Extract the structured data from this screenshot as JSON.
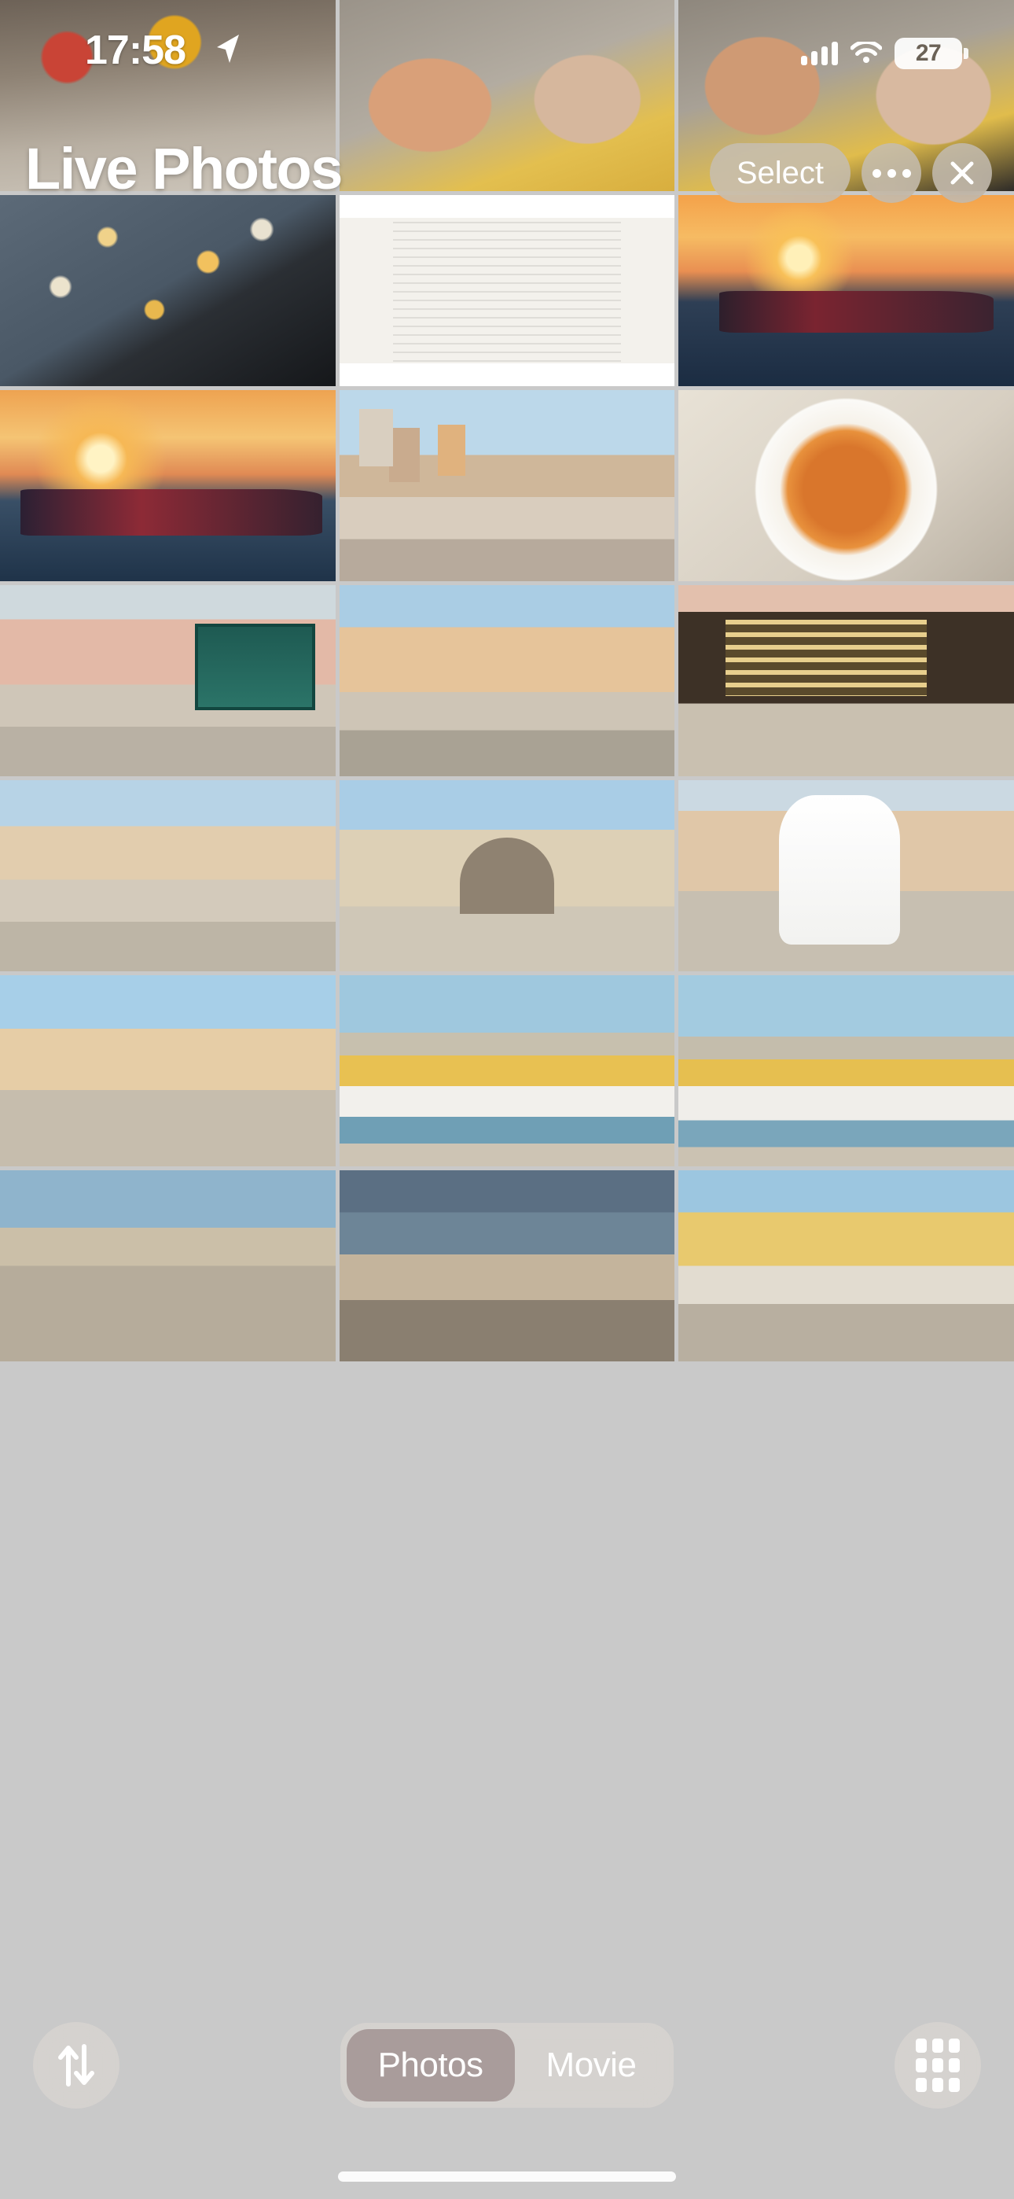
{
  "status_bar": {
    "time": "17:58",
    "location_icon": "location-arrow-icon",
    "cellular_icon": "cellular-signal-icon",
    "wifi_icon": "wifi-icon",
    "battery_level": "27"
  },
  "nav_bar": {
    "title": "Live Photos",
    "select_label": "Select",
    "more_icon": "ellipsis-icon",
    "close_icon": "close-x-icon"
  },
  "bottom_bar": {
    "sort_icon": "sort-arrows-icon",
    "grid_icon": "grid-view-icon",
    "segments": [
      {
        "label": "Photos",
        "active": true
      },
      {
        "label": "Movie",
        "active": false
      }
    ]
  },
  "colors": {
    "selection_border": "#ff0000",
    "grid_background": "#c9c9c9",
    "chrome_fill": "rgba(198,190,180,0.82)",
    "toolbar_fill": "rgba(214,211,207,0.86)",
    "segment_active": "rgba(150,133,133,0.70)"
  },
  "grid": {
    "columns": 3,
    "selected_index": 3,
    "items": [
      {
        "name": "crowd-street-scene",
        "art": "a-crowd",
        "selected": false
      },
      {
        "name": "selfie-couple-square-1",
        "art": "a-selfie1",
        "selected": false
      },
      {
        "name": "selfie-couple-square-2",
        "art": "a-selfie2",
        "selected": false
      },
      {
        "name": "star-projector-box",
        "art": "a-stars",
        "selected": false
      },
      {
        "name": "official-document-scan",
        "art": "a-doc",
        "selected": false
      },
      {
        "name": "sunset-boat-harbor",
        "art": "a-sunsetboat1",
        "selected": false
      },
      {
        "name": "taxi-boat-sunset",
        "art": "a-taxiboat",
        "selected": true
      },
      {
        "name": "old-town-waterfront",
        "art": "a-town",
        "selected": false
      },
      {
        "name": "vegetable-soup-bowl",
        "art": "a-soup",
        "selected": false
      },
      {
        "name": "cobblestone-street-shop",
        "art": "a-street1",
        "selected": false
      },
      {
        "name": "narrow-street-scooter",
        "art": "a-street2",
        "selected": false
      },
      {
        "name": "jewelry-shop-window",
        "art": "a-street3",
        "selected": false
      },
      {
        "name": "town-square-cafe",
        "art": "a-square",
        "selected": false
      },
      {
        "name": "stone-arch-gate",
        "art": "a-arch",
        "selected": false
      },
      {
        "name": "stilt-walker-performer",
        "art": "a-stilt",
        "selected": false
      },
      {
        "name": "square-balloon-artist",
        "art": "a-square2",
        "selected": false
      },
      {
        "name": "delfin-tour-boat-1",
        "art": "a-boat1",
        "selected": false
      },
      {
        "name": "delfin-tour-boat-2",
        "art": "a-boat2",
        "selected": false
      },
      {
        "name": "harbor-evening-promenade",
        "art": "a-harbor",
        "selected": false
      },
      {
        "name": "seaside-dusk-view",
        "art": "a-seaside",
        "selected": false
      },
      {
        "name": "colorful-waterfront-cafes",
        "art": "a-waterfront",
        "selected": false
      }
    ]
  }
}
